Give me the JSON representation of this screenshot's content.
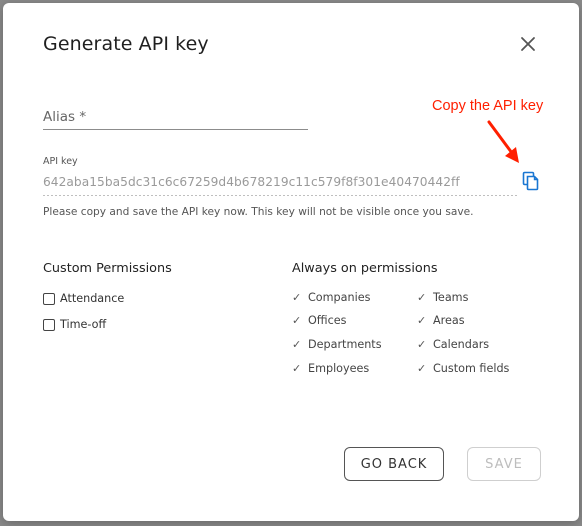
{
  "dialog": {
    "title": "Generate API key",
    "close_icon": "close-icon"
  },
  "alias": {
    "label": "Alias *",
    "value": ""
  },
  "annotation": {
    "text": "Copy the API key",
    "color": "#ff1f00"
  },
  "api_key": {
    "label": "API key",
    "value": "642aba15ba5dc31c6c67259d4b678219c11c579f8f301e40470442ff",
    "copy_icon": "copy-icon",
    "copy_icon_color": "#1976d2",
    "hint": "Please copy and save the API key now. This key will not be visible once you save."
  },
  "custom_permissions": {
    "title": "Custom Permissions",
    "items": [
      {
        "label": "Attendance",
        "checked": false
      },
      {
        "label": "Time-off",
        "checked": false
      }
    ]
  },
  "always_on_permissions": {
    "title": "Always on permissions",
    "items": [
      "Companies",
      "Teams",
      "Offices",
      "Areas",
      "Departments",
      "Calendars",
      "Employees",
      "Custom fields"
    ]
  },
  "buttons": {
    "go_back": "GO BACK",
    "save": "SAVE",
    "save_enabled": false
  }
}
